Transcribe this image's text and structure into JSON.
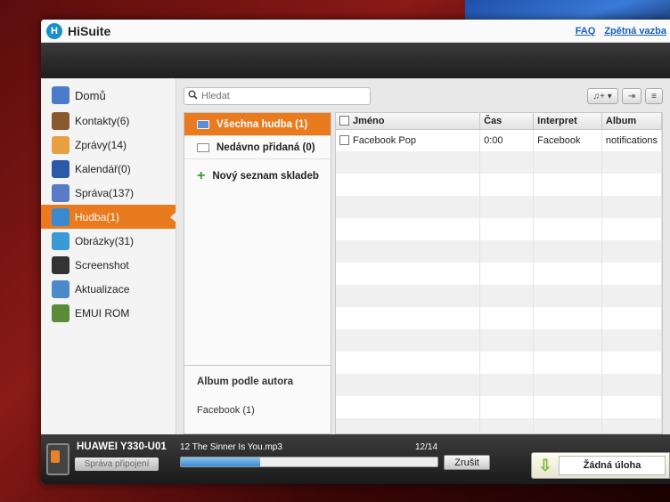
{
  "app": {
    "logo_letter": "H",
    "title": "HiSuite",
    "links": [
      "FAQ",
      "Zpětná vazba"
    ]
  },
  "sidebar": {
    "items": [
      {
        "label": "Domů",
        "icon": "home-icon",
        "color": "#4a7cc9"
      },
      {
        "label": "Kontakty(6)",
        "icon": "contacts-icon",
        "color": "#8a5a2e"
      },
      {
        "label": "Zprávy(14)",
        "icon": "messages-icon",
        "color": "#e8a040"
      },
      {
        "label": "Kalendář(0)",
        "icon": "calendar-icon",
        "color": "#2a5aa8"
      },
      {
        "label": "Správa(137)",
        "icon": "apps-icon",
        "color": "#5a7ac8"
      },
      {
        "label": "Hudba(1)",
        "icon": "music-icon",
        "color": "#3a8ad2",
        "active": true
      },
      {
        "label": "Obrázky(31)",
        "icon": "pictures-icon",
        "color": "#3a9ad8"
      },
      {
        "label": "Screenshot",
        "icon": "camera-icon",
        "color": "#333333"
      },
      {
        "label": "Aktualizace",
        "icon": "update-icon",
        "color": "#4a8ac8"
      },
      {
        "label": "EMUI ROM",
        "icon": "rom-icon",
        "color": "#5a8a3a"
      }
    ]
  },
  "search": {
    "placeholder": "Hledat"
  },
  "playlists": {
    "items": [
      "Všechna hudba (1)",
      "Nedávno přidaná (0)"
    ],
    "new_label": "Nový seznam skladeb",
    "album_heading": "Album podle autora",
    "albums": [
      "Facebook (1)"
    ]
  },
  "table": {
    "columns": [
      "Jméno",
      "Čas",
      "Interpret",
      "Album"
    ],
    "rows": [
      {
        "name": "Facebook Pop",
        "time": "0:00",
        "artist": "Facebook",
        "album": "notifications"
      }
    ]
  },
  "status": {
    "device": "HUAWEI Y330-U01",
    "manage_label": "Správa připojení",
    "current_file": "12 The Sinner Is You.mp3",
    "counter": "12/14",
    "progress": 0.31,
    "cancel_label": "Zrušit",
    "task_label": "Žádná úloha"
  },
  "colors": {
    "accent": "#ea7a1e",
    "progress": "#3a8ad2"
  }
}
